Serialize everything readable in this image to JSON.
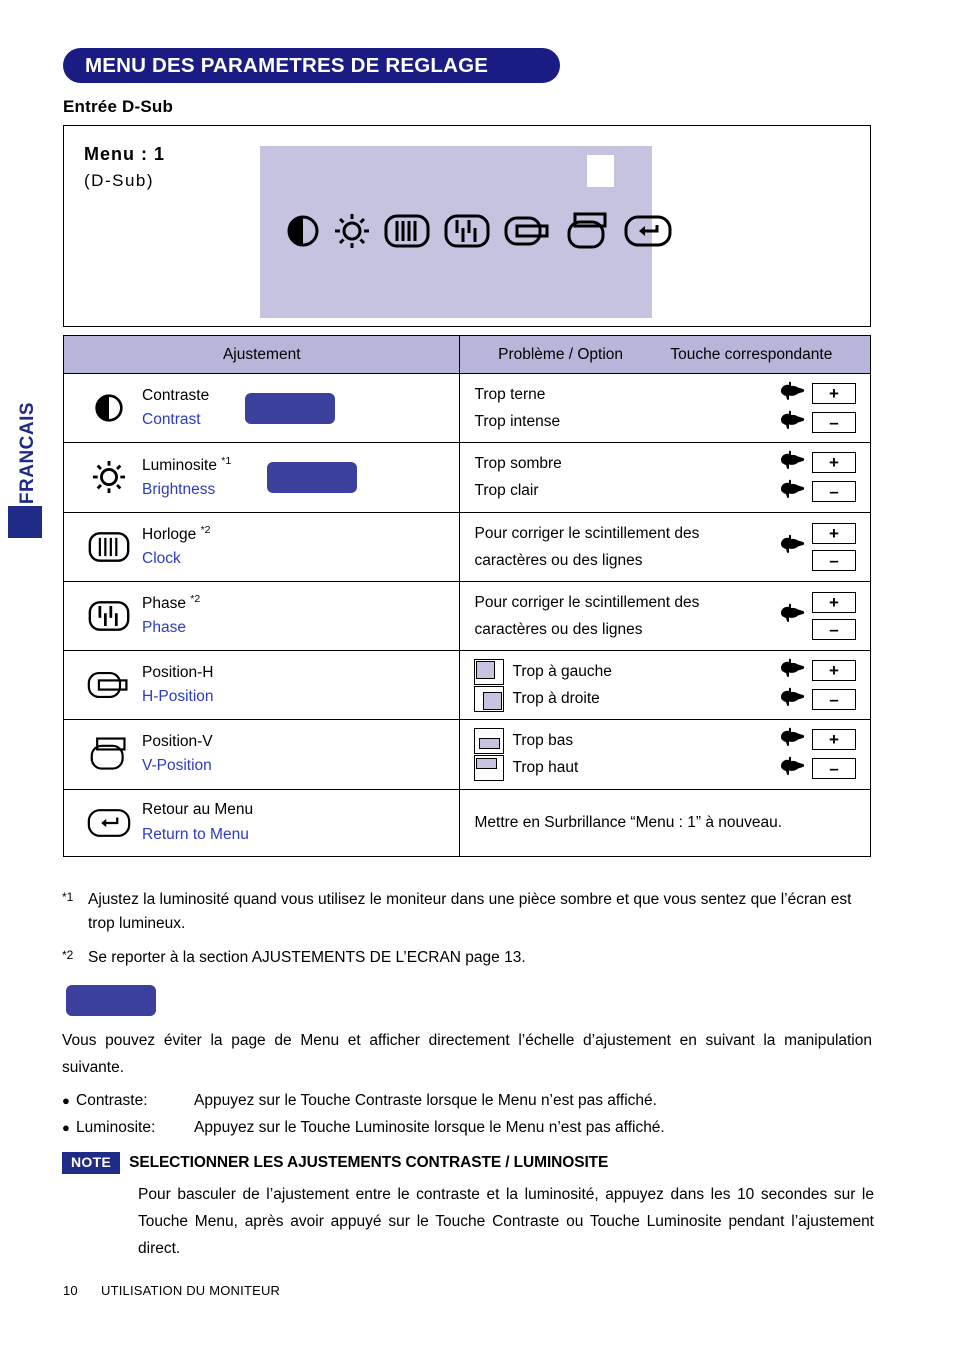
{
  "sidebar": {
    "language_tab": "FRANCAIS"
  },
  "header": {
    "banner_title": "MENU DES PARAMETRES DE REGLAGE",
    "subtitle": "Entrée D-Sub"
  },
  "osd": {
    "menu_label": "Menu : 1",
    "input_label": "(D-Sub)",
    "icons": [
      "contrast-icon",
      "brightness-icon",
      "clock-icon",
      "phase-icon",
      "h-position-icon",
      "v-position-icon",
      "return-icon"
    ]
  },
  "table": {
    "headers": {
      "adjustment": "Ajustement",
      "problem": "Problème / Option",
      "key": "Touche correspondante"
    },
    "rows": [
      {
        "icon": "contrast-icon",
        "label_fr": "Contraste",
        "label_en": "Contrast",
        "footnote": "",
        "redacted": true,
        "problems": [
          "Trop terne",
          "Trop intense"
        ],
        "keys": [
          "+",
          "–"
        ],
        "keys_mode": "paired"
      },
      {
        "icon": "brightness-icon",
        "label_fr": "Luminosite",
        "label_en": "Brightness",
        "footnote": "*1",
        "redacted": true,
        "problems": [
          "Trop sombre",
          "Trop clair"
        ],
        "keys": [
          "+",
          "–"
        ],
        "keys_mode": "paired"
      },
      {
        "icon": "clock-icon",
        "label_fr": "Horloge",
        "label_en": "Clock",
        "footnote": "*2",
        "redacted": false,
        "problems": [
          "Pour corriger le scintillement des",
          "caractères ou des lignes"
        ],
        "keys": [
          "+",
          "–"
        ],
        "keys_mode": "single"
      },
      {
        "icon": "phase-icon",
        "label_fr": "Phase",
        "label_en": "Phase",
        "footnote": "*2",
        "redacted": false,
        "problems": [
          "Pour corriger le scintillement des",
          "caractères ou des lignes"
        ],
        "keys": [
          "+",
          "–"
        ],
        "keys_mode": "single"
      },
      {
        "icon": "h-position-icon",
        "label_fr": "Position-H",
        "label_en": "H-Position",
        "footnote": "",
        "redacted": false,
        "problems": [
          "Trop à gauche",
          "Trop à droite"
        ],
        "keys": [
          "+",
          "–"
        ],
        "keys_mode": "paired",
        "mini": [
          "box-left",
          "box-right"
        ]
      },
      {
        "icon": "v-position-icon",
        "label_fr": "Position-V",
        "label_en": "V-Position",
        "footnote": "",
        "redacted": false,
        "problems": [
          "Trop bas",
          "Trop haut"
        ],
        "keys": [
          "+",
          "–"
        ],
        "keys_mode": "paired",
        "mini": [
          "box-top",
          "box-bottom"
        ]
      },
      {
        "icon": "return-icon",
        "label_fr": "Retour au Menu",
        "label_en": "Return to Menu",
        "footnote": "",
        "redacted": false,
        "problems": [
          "Mettre en Surbrillance “Menu : 1” à nouveau."
        ],
        "keys": [],
        "keys_mode": "none"
      }
    ]
  },
  "footnotes": [
    {
      "mark": "*1",
      "text": "Ajustez la luminosité quand vous utilisez le moniteur dans une pièce sombre et que vous sentez que l’écran est trop lumineux."
    },
    {
      "mark": "*2",
      "text": "Se reporter à la section AJUSTEMENTS DE L’ECRAN page 13."
    }
  ],
  "direct": {
    "paragraph": "Vous pouvez éviter la page de Menu et afficher directement l’échelle d’ajustement en suivant la manipulation suivante.",
    "items": [
      {
        "key": "Contraste:",
        "value": "Appuyez sur le Touche Contraste lorsque le Menu n’est pas affiché."
      },
      {
        "key": "Luminosite:",
        "value": "Appuyez sur le Touche Luminosite lorsque le Menu n’est pas affiché."
      }
    ]
  },
  "note": {
    "badge": "NOTE",
    "title": "SELECTIONNER LES AJUSTEMENTS CONTRASTE / LUMINOSITE",
    "body": "Pour basculer de l’ajustement entre le contraste et la luminosité, appuyez dans les 10 secondes sur le Touche Menu, après avoir appuyé sur le Touche Contraste ou Touche Luminosite pendant l’ajustement direct."
  },
  "footer": {
    "page_number": "10",
    "section": "UTILISATION DU MONITEUR"
  },
  "colors": {
    "banner_blue": "#1b1b84",
    "redaction_blue": "#3a409b",
    "screen_lavender": "#c5c3e0",
    "header_lavender": "#b7b6da",
    "link_blue": "#2c3cc4",
    "tab_blue": "#1f2b86"
  }
}
